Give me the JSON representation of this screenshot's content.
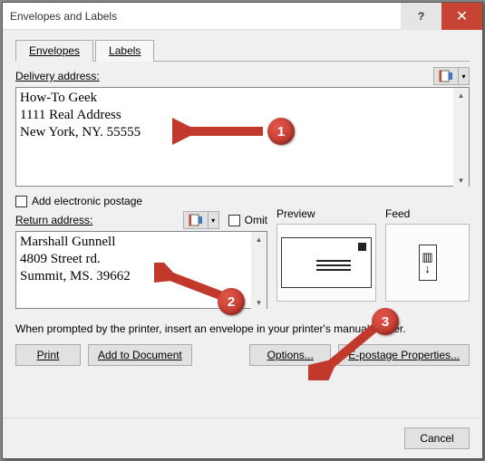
{
  "dialog": {
    "title": "Envelopes and Labels"
  },
  "tabs": {
    "envelopes": "Envelopes",
    "labels": "Labels"
  },
  "delivery": {
    "label": "Delivery address:",
    "value": "How-To Geek\n1111 Real Address\nNew York, NY. 55555"
  },
  "postage_chk": "Add electronic postage",
  "return": {
    "label": "Return address:",
    "omit": "Omit",
    "value": "Marshall Gunnell\n4809 Street rd.\nSummit, MS. 39662"
  },
  "preview": {
    "label": "Preview"
  },
  "feed": {
    "label": "Feed"
  },
  "hint": "When prompted by the printer, insert an envelope in your printer's manual feeder.",
  "buttons": {
    "print": "Print",
    "add": "Add to Document",
    "options": "Options...",
    "epostage": "E-postage Properties...",
    "cancel": "Cancel"
  },
  "annotations": {
    "b1": "1",
    "b2": "2",
    "b3": "3"
  }
}
